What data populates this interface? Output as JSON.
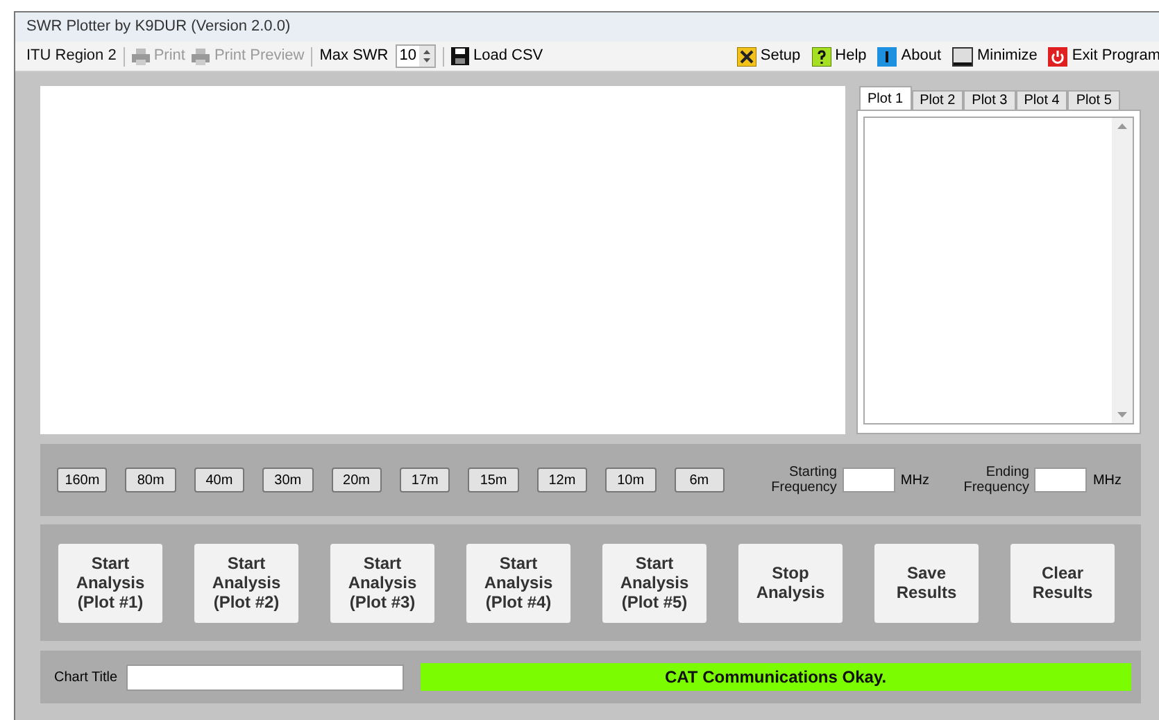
{
  "window": {
    "title": "SWR Plotter by K9DUR (Version 2.0.0)"
  },
  "toolbar": {
    "region": "ITU Region 2",
    "print": {
      "label": "Print",
      "disabled": true
    },
    "print_preview": {
      "label": "Print Preview",
      "disabled": true
    },
    "max_swr": {
      "label": "Max SWR",
      "value": "10"
    },
    "load_csv": "Load CSV",
    "right": [
      {
        "kind": "setup",
        "label": "Setup"
      },
      {
        "kind": "help",
        "label": "Help"
      },
      {
        "kind": "about",
        "label": "About"
      },
      {
        "kind": "minimize",
        "label": "Minimize"
      },
      {
        "kind": "exit",
        "label": "Exit Program"
      }
    ]
  },
  "plot_tabs": [
    {
      "label": "Plot 1",
      "selected": true
    },
    {
      "label": "Plot 2",
      "selected": false
    },
    {
      "label": "Plot 3",
      "selected": false
    },
    {
      "label": "Plot 4",
      "selected": false
    },
    {
      "label": "Plot 5",
      "selected": false
    }
  ],
  "bands": [
    "160m",
    "80m",
    "40m",
    "30m",
    "20m",
    "17m",
    "15m",
    "12m",
    "10m",
    "6m"
  ],
  "starting_frequency": {
    "label": "Starting Frequency",
    "unit": "MHz"
  },
  "ending_frequency": {
    "label": "Ending Frequency",
    "unit": "MHz"
  },
  "actions": [
    "Start Analysis (Plot #1)",
    "Start Analysis (Plot #2)",
    "Start Analysis (Plot #3)",
    "Start Analysis (Plot #4)",
    "Start Analysis (Plot #5)",
    "Stop Analysis",
    "Save Results",
    "Clear Results"
  ],
  "chart_title": {
    "label": "Chart Title"
  },
  "status": "CAT Communications Okay."
}
